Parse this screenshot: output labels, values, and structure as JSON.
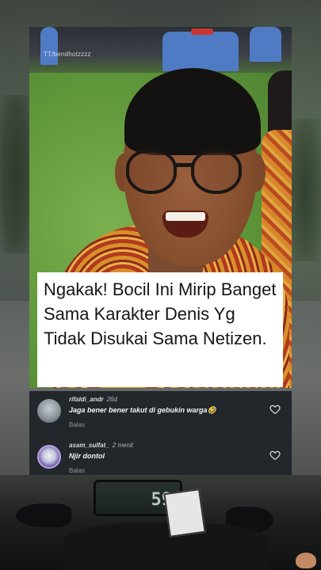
{
  "video": {
    "watermark": "TT/bendhotzzzz",
    "caption": "Ngakak! Bocil Ini Mirip Banget Sama Karakter Denis Yg Tidak Disukai Sama Netizen."
  },
  "comments": [
    {
      "username": "rifaldi_andr",
      "time": "26d",
      "text": "Jaga bener bener takut di gebukin warga🤣",
      "reply_label": "Balas",
      "avatar_icon": "user-avatar-photo",
      "like_icon": "heart-outline-icon"
    },
    {
      "username": "asam_sulfat_",
      "time": "2 menit",
      "text": "Njir dontol",
      "reply_label": "Balas",
      "avatar_icon": "user-avatar-photo",
      "like_icon": "heart-outline-icon"
    }
  ],
  "dashboard": {
    "speed_readout": "59"
  },
  "colors": {
    "caption_bg": "#ffffff",
    "caption_text": "#161616",
    "comment_panel_bg": "#22272b"
  }
}
